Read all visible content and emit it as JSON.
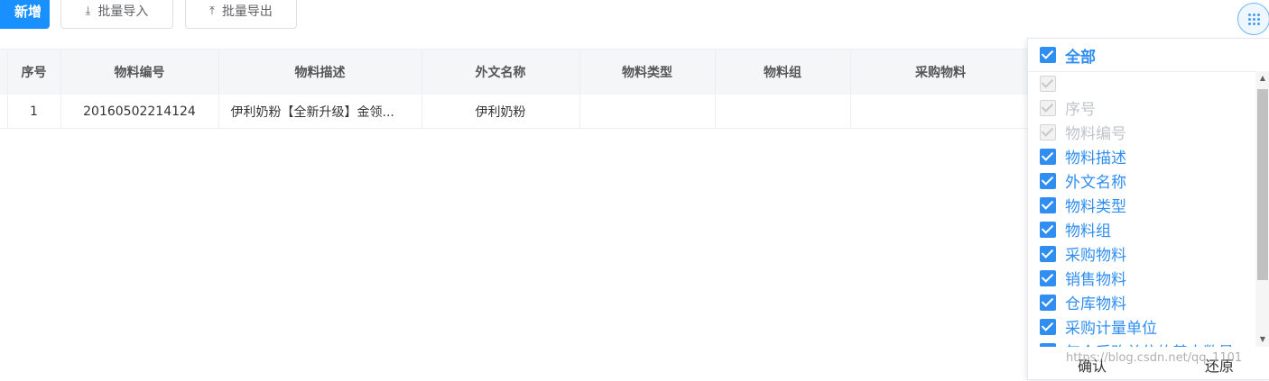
{
  "toolbar": {
    "add_label": "新增",
    "import_label": "批量导入",
    "export_label": "批量导出"
  },
  "table": {
    "headers": [
      "序号",
      "物料编号",
      "物料描述",
      "外文名称",
      "物料类型",
      "物料组",
      "采购物料"
    ],
    "rows": [
      {
        "index": "1",
        "code": "20160502214124",
        "desc": "伊利奶粉【全新升级】金领...",
        "foreign_name": "伊利奶粉",
        "type": "",
        "group": "",
        "purchase": ""
      }
    ]
  },
  "column_panel": {
    "all_label": "全部",
    "items": [
      {
        "label": "",
        "checked": true,
        "disabled": true
      },
      {
        "label": "序号",
        "checked": true,
        "disabled": true
      },
      {
        "label": "物料编号",
        "checked": true,
        "disabled": true
      },
      {
        "label": "物料描述",
        "checked": true,
        "disabled": false
      },
      {
        "label": "外文名称",
        "checked": true,
        "disabled": false
      },
      {
        "label": "物料类型",
        "checked": true,
        "disabled": false
      },
      {
        "label": "物料组",
        "checked": true,
        "disabled": false
      },
      {
        "label": "采购物料",
        "checked": true,
        "disabled": false
      },
      {
        "label": "销售物料",
        "checked": true,
        "disabled": false
      },
      {
        "label": "仓库物料",
        "checked": true,
        "disabled": false
      },
      {
        "label": "采购计量单位",
        "checked": true,
        "disabled": false
      },
      {
        "label": "每个采购单位的基本数量",
        "checked": true,
        "disabled": false
      }
    ],
    "confirm_label": "确认",
    "reset_label": "还原"
  },
  "watermark": "https://blog.csdn.net/qq_1101"
}
